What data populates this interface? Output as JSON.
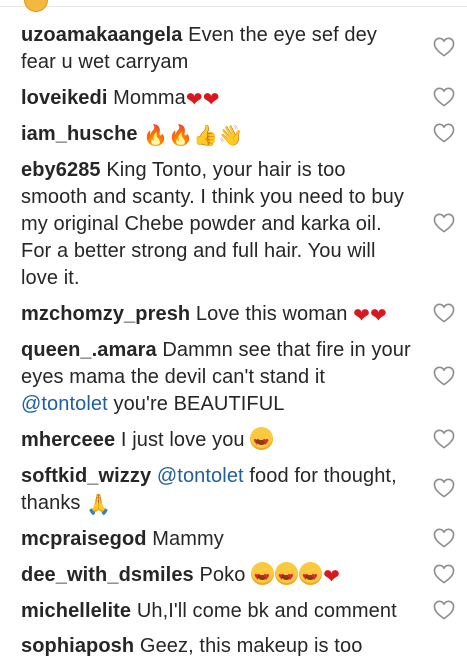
{
  "comments": [
    {
      "user": "uzoamakaangela",
      "pre": "Even the eye sef dey fear u wet carryam",
      "mention": "",
      "post": "",
      "emoji": ""
    },
    {
      "user": "loveikedi",
      "pre": "Momma",
      "mention": "",
      "post": "",
      "emoji": "❤❤"
    },
    {
      "user": "iam_husche",
      "pre": "",
      "mention": "",
      "post": "",
      "emoji": "🔥🔥👍👋"
    },
    {
      "user": "eby6285",
      "pre": "King Tonto, your hair is too smooth and scanty. I think you need to buy my original Chebe powder and karka oil. For a better strong and full hair. You will love it.",
      "mention": "",
      "post": "",
      "emoji": ""
    },
    {
      "user": "mzchomzy_presh",
      "pre": "Love this woman",
      "mention": "",
      "post": "",
      "emoji": "❤❤"
    },
    {
      "user": "queen_.amara",
      "pre": "Dammn see that fire in your eyes mama the devil can't stand it",
      "mention": "@tontolet",
      "post": "you're BEAUTIFUL",
      "emoji": ""
    },
    {
      "user": "mherceee",
      "pre": "I just love you",
      "mention": "",
      "post": "",
      "emoji": "😍"
    },
    {
      "user": "softkid_wizzy",
      "pre": "",
      "mention": "@tontolet",
      "post": "food for thought, thanks",
      "emoji": "🙏"
    },
    {
      "user": "mcpraisegod",
      "pre": "Mammy",
      "mention": "",
      "post": "",
      "emoji": ""
    },
    {
      "user": "dee_with_dsmiles",
      "pre": "Poko",
      "mention": "",
      "post": "",
      "emoji": "😍😍😍❤"
    },
    {
      "user": "michellelite",
      "pre": "Uh,I'll come bk and comment",
      "mention": "",
      "post": "",
      "emoji": ""
    },
    {
      "user": "sophiaposh",
      "pre": "Geez, this makeup is too",
      "mention": "",
      "post": "",
      "emoji": ""
    }
  ],
  "icons": {
    "like": "heart-outline-icon"
  },
  "colors": {
    "mention": "#1f5f9e",
    "text": "#262626",
    "heart_outline": "#8e8e8e"
  }
}
